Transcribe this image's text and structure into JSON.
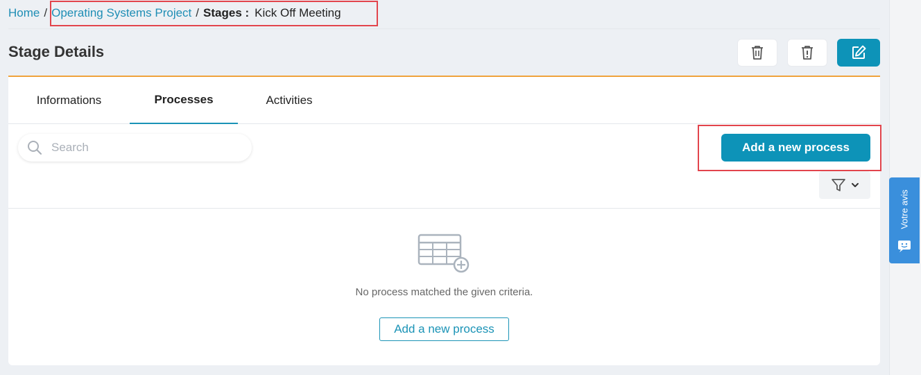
{
  "breadcrumb": {
    "home": "Home",
    "separator": "/",
    "project": "Operating Systems Project",
    "stages_label": "Stages :",
    "current": "Kick Off Meeting"
  },
  "header": {
    "title": "Stage Details",
    "actions": [
      "trash-icon",
      "archive-icon",
      "edit-icon"
    ]
  },
  "tabs": [
    {
      "label": "Informations",
      "active": false
    },
    {
      "label": "Processes",
      "active": true
    },
    {
      "label": "Activities",
      "active": false
    }
  ],
  "search": {
    "placeholder": "Search",
    "value": ""
  },
  "toolbar": {
    "add_process_label": "Add a new process",
    "filter_icon": "filter-icon"
  },
  "empty_state": {
    "icon": "table-add-icon",
    "message": "No process matched the given criteria.",
    "button_label": "Add a new process"
  },
  "feedback": {
    "label": "Votre avis"
  },
  "colors": {
    "primary": "#0d93b8",
    "link": "#1f8eb5",
    "accent": "#f0a23a",
    "highlight": "#e2444c",
    "feedback": "#3a8fdc"
  }
}
